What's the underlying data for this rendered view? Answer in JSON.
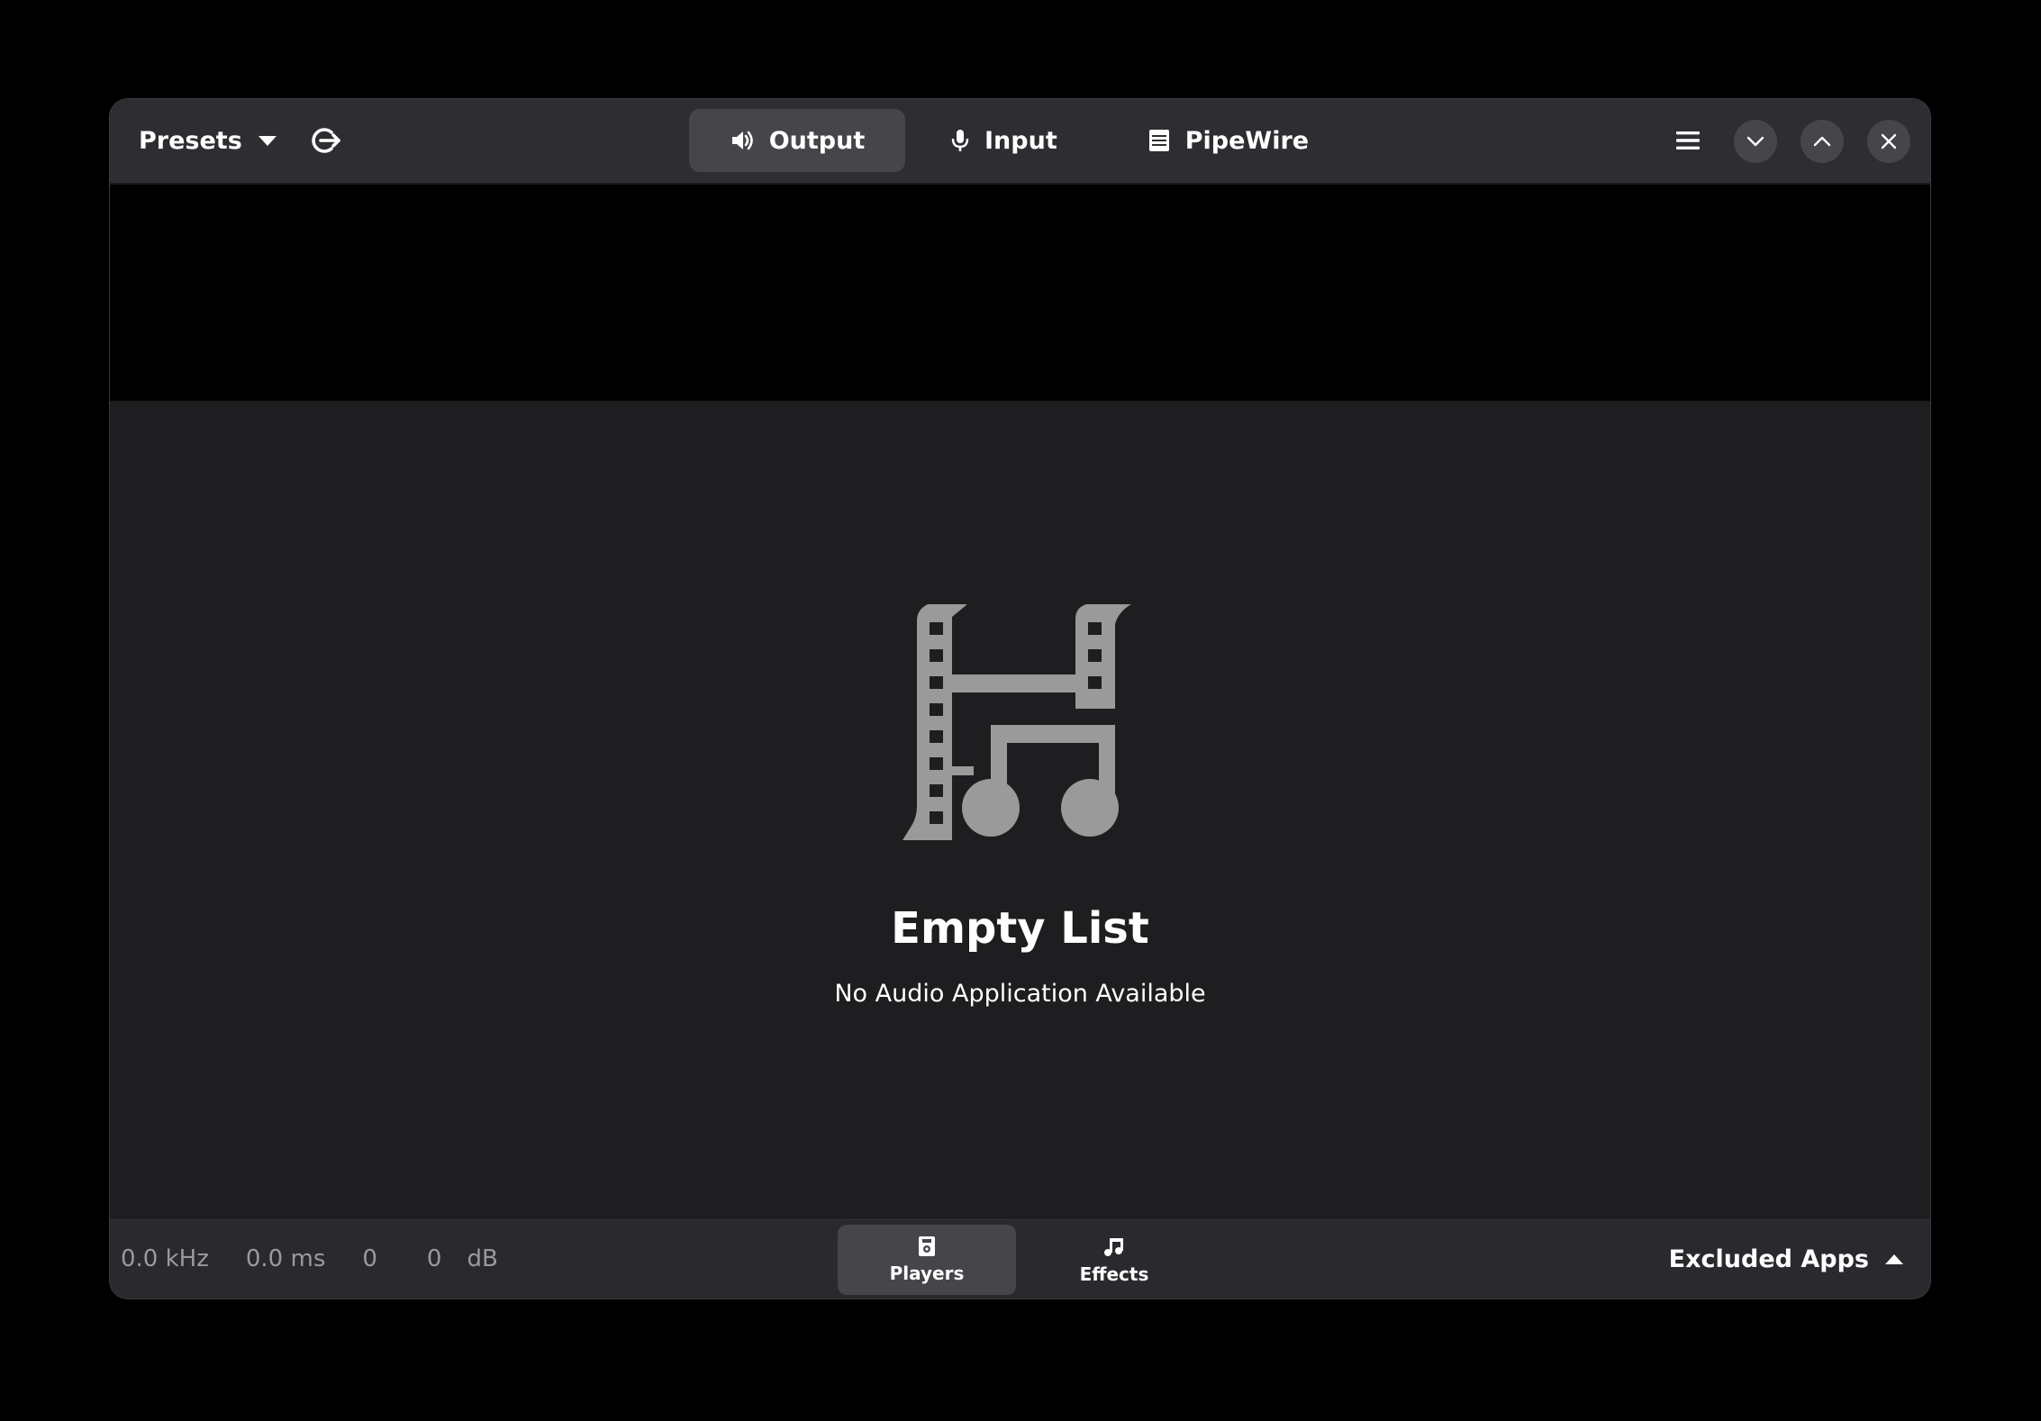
{
  "header": {
    "presets_label": "Presets",
    "tabs": [
      {
        "label": "Output",
        "icon": "speaker-icon",
        "active": true
      },
      {
        "label": "Input",
        "icon": "microphone-icon",
        "active": false
      },
      {
        "label": "PipeWire",
        "icon": "server-icon",
        "active": false
      }
    ]
  },
  "content": {
    "title": "Empty List",
    "description": "No Audio Application Available",
    "icon": "multimedia-icon"
  },
  "statusbar": {
    "rate": "0.0 kHz",
    "latency": "0.0 ms",
    "level_left": "0",
    "level_right": "0",
    "unit": "dB"
  },
  "bottom_tabs": [
    {
      "label": "Players",
      "icon": "media-player-icon",
      "active": true
    },
    {
      "label": "Effects",
      "icon": "music-note-icon",
      "active": false
    }
  ],
  "excluded_apps_label": "Excluded Apps",
  "colors": {
    "accent_tab_bg": "#45454a",
    "header_bg": "#2e2e32",
    "content_bg": "#1e1e20",
    "icon_gray": "#9a9a9a"
  }
}
